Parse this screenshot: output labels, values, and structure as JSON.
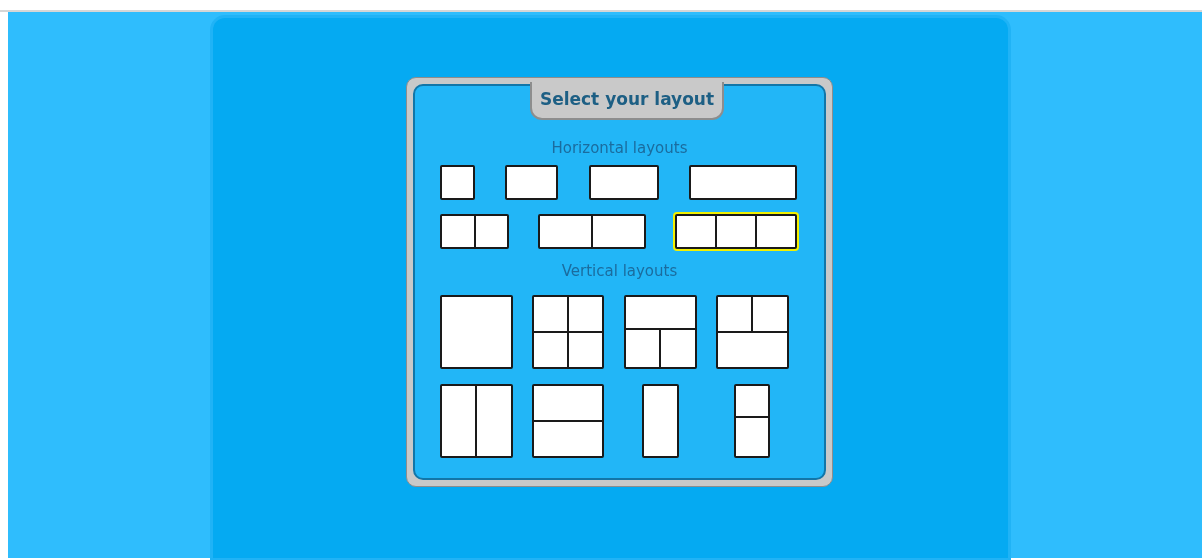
{
  "dialog": {
    "title": "Select your layout",
    "sections": [
      {
        "heading": "Horizontal layouts",
        "rows": [
          [
            {
              "kind": "small",
              "selected": false
            },
            {
              "kind": "medium",
              "selected": false
            },
            {
              "kind": "large",
              "selected": false
            },
            {
              "kind": "wide",
              "selected": false
            }
          ],
          [
            {
              "kind": "two-up",
              "selected": false
            },
            {
              "kind": "two-up-wide",
              "selected": false
            },
            {
              "kind": "three-up",
              "selected": true
            }
          ]
        ]
      },
      {
        "heading": "Vertical layouts",
        "rows": [
          [
            {
              "kind": "full",
              "selected": false
            },
            {
              "kind": "quad",
              "selected": false
            },
            {
              "kind": "one-over-two",
              "selected": false
            },
            {
              "kind": "two-over-one",
              "selected": false
            }
          ],
          [
            {
              "kind": "side-by-side",
              "selected": false
            },
            {
              "kind": "stacked",
              "selected": false
            },
            {
              "kind": "narrow",
              "selected": false
            },
            {
              "kind": "narrow-stacked",
              "selected": false
            }
          ]
        ]
      }
    ]
  }
}
